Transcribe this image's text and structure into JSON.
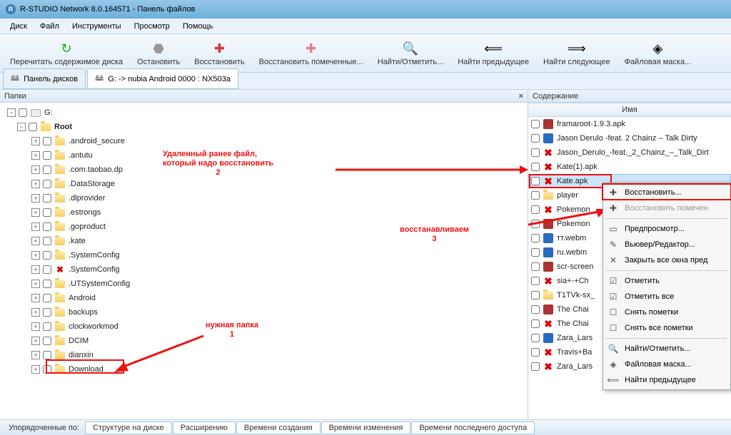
{
  "title": "R-STUDIO Network 8.0.164571 - Панель файлов",
  "menu": [
    "Диск",
    "Файл",
    "Инструменты",
    "Просмотр",
    "Помощь"
  ],
  "toolbar": [
    {
      "icon": "↻",
      "color": "#2a2",
      "label": "Перечитать содержимое диска"
    },
    {
      "icon": "⬣",
      "color": "#999",
      "label": "Остановить"
    },
    {
      "icon": "✚",
      "color": "#d33",
      "label": "Восстановить"
    },
    {
      "icon": "✚",
      "color": "#d88",
      "label": "Восстановить помеченные..."
    },
    {
      "icon": "🔍",
      "color": "#888",
      "label": "Найти/Отметить..."
    },
    {
      "icon": "⟸",
      "color": "#bba",
      "label": "Найти предыдущее"
    },
    {
      "icon": "⟹",
      "color": "#bba",
      "label": "Найти следующее"
    },
    {
      "icon": "◈",
      "color": "#cb8",
      "label": "Файловая маска..."
    }
  ],
  "drivetabs": {
    "t1": "Панель дисков",
    "t2": "G: -> nubia Android 0000 : NX503a"
  },
  "left": {
    "header": "Папки"
  },
  "tree": {
    "root_drive": "G:",
    "root_folder": "Root",
    "items": [
      ".android_secure",
      ".antutu",
      ".com.taobao.dp",
      ".DataStorage",
      ".dlprovider",
      ".estrongs",
      ".goproduct",
      ".kate",
      ".SystemConfig",
      ".SystemConfig",
      ".UTSystemConfig",
      "Android",
      "backups",
      "clockworkmod",
      "DCIM",
      "dianxin",
      "Download"
    ],
    "deleted_index": 9
  },
  "right": {
    "header": "Содержание",
    "col": "Имя"
  },
  "files": [
    {
      "n": "framaroot-1.9.3.apk",
      "t": "apk",
      "d": false
    },
    {
      "n": "Jason Derulo -feat. 2 Chainz – Talk Dirty",
      "t": "webm",
      "d": false
    },
    {
      "n": "Jason_Derulo_-feat._2_Chainz_–_Talk_Dirt",
      "t": "del",
      "d": true
    },
    {
      "n": "Kate(1).apk",
      "t": "del",
      "d": true
    },
    {
      "n": "Kate.apk",
      "t": "del",
      "d": true,
      "sel": true
    },
    {
      "n": "player",
      "t": "fld",
      "d": false
    },
    {
      "n": "Pokemon",
      "t": "del",
      "d": true
    },
    {
      "n": "Pokemon",
      "t": "apk",
      "d": false
    },
    {
      "n": "тт.webm",
      "t": "webm",
      "d": false
    },
    {
      "n": "ru.webm",
      "t": "webm",
      "d": false
    },
    {
      "n": "scr-screen",
      "t": "apk",
      "d": false
    },
    {
      "n": "sia+-+Ch",
      "t": "del",
      "d": true
    },
    {
      "n": "T1TVk-sx_",
      "t": "fld",
      "d": false
    },
    {
      "n": "The Chai",
      "t": "apk",
      "d": false
    },
    {
      "n": "The Chai",
      "t": "del",
      "d": true
    },
    {
      "n": "Zara_Lars",
      "t": "webm",
      "d": false
    },
    {
      "n": "Travis+Ba",
      "t": "del",
      "d": true
    },
    {
      "n": "Zara_Lars",
      "t": "del",
      "d": true
    }
  ],
  "ctx": {
    "recover": "Восстановить...",
    "recover_marked": "Восстановить помечен",
    "preview": "Предпросмотр...",
    "view_edit": "Вьювер/Редактор...",
    "close_all": "Закрыть все окна пред",
    "mark": "Отметить",
    "mark_all": "Отметить все",
    "unmark": "Снять пометки",
    "unmark_all": "Снять все пометки",
    "find": "Найти/Отметить...",
    "filemask": "Файловая маска...",
    "find_prev": "Найти предыдущее"
  },
  "bottom": {
    "sortlabel": "Упорядоченные по:",
    "tabs": [
      "Структуре на диске",
      "Расширению",
      "Времени создания",
      "Времени изменения",
      "Времени последнего доступа"
    ]
  },
  "anno": {
    "a1": "Удаленный ранее файл,",
    "a1b": "который надо восстановить",
    "a1c": "2",
    "a2": "восстанавливаем",
    "a2b": "3",
    "a3": "нужная папка",
    "a3b": "1"
  }
}
